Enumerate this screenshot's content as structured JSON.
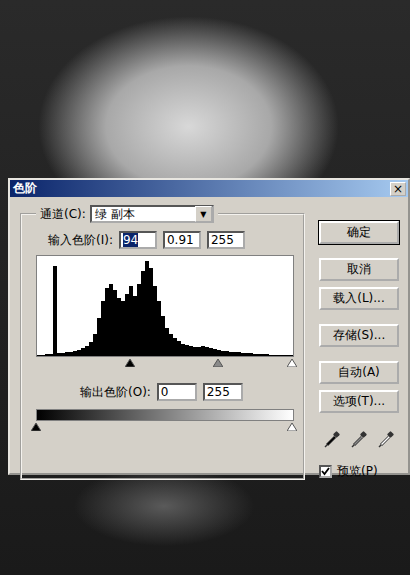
{
  "window": {
    "title": "色阶",
    "close": "×"
  },
  "channel": {
    "label": "通道(C):",
    "value": "绿 副本",
    "arrow": "▼"
  },
  "input_levels": {
    "label": "输入色阶(I):",
    "fields": [
      {
        "value": "94",
        "selected": true
      },
      {
        "value": "0.91",
        "selected": false
      },
      {
        "value": "255",
        "selected": false
      }
    ]
  },
  "histogram": {
    "values": [
      1,
      1,
      2,
      2,
      90,
      3,
      3,
      4,
      4,
      5,
      6,
      8,
      10,
      14,
      22,
      38,
      55,
      68,
      72,
      66,
      58,
      55,
      62,
      70,
      60,
      72,
      85,
      95,
      88,
      70,
      55,
      40,
      28,
      22,
      18,
      15,
      12,
      11,
      10,
      9,
      9,
      10,
      9,
      8,
      7,
      6,
      5,
      5,
      4,
      4,
      4,
      3,
      3,
      3,
      2,
      2,
      2,
      2,
      1,
      1,
      1,
      1,
      1,
      1
    ]
  },
  "input_sliders": [
    {
      "kind": "black",
      "level": 0.369
    },
    {
      "kind": "gray",
      "level": 0.71
    },
    {
      "kind": "white",
      "level": 1
    }
  ],
  "output_levels": {
    "label": "输出色阶(O):",
    "fields": [
      {
        "value": "0",
        "selected": false
      },
      {
        "value": "255",
        "selected": false
      }
    ]
  },
  "output_sliders": [
    {
      "kind": "black",
      "level": 0
    },
    {
      "kind": "white",
      "level": 1
    }
  ],
  "buttons": [
    {
      "label": "确定",
      "default": true
    },
    {
      "label": "取消",
      "default": false
    },
    {
      "label": "载入(L)...",
      "default": false
    },
    {
      "label": "存储(S)...",
      "default": false
    },
    {
      "label": "自动(A)",
      "default": false
    },
    {
      "label": "选项(T)...",
      "default": false
    }
  ],
  "eyedroppers": [
    {
      "kind": "black"
    },
    {
      "kind": "gray"
    },
    {
      "kind": "white"
    }
  ],
  "preview": {
    "label": "预览(P)",
    "checked": true
  }
}
